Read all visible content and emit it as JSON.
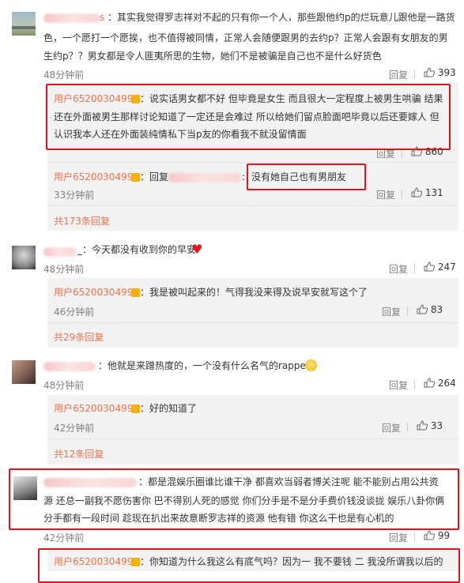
{
  "c1": {
    "name_suffix": "s",
    "line1": "：其实我觉得罗志祥对不起的只有你一个人，那些跟他约p的烂玩意儿跟他是一路货",
    "line2": "色，一个愿打一个愿挨，也不值得被同情，正常人会随便跟男的去约p？正常人会跟有女朋友的男",
    "line3": "生约p？？男女都是令人匪夷所思的生物，她们不是被骗是自己也不是什么好货色",
    "time": "48分钟前",
    "reply": "回复",
    "likes": "393"
  },
  "r1": {
    "user": "用户6520030499",
    "line1": "：说实话男女都不好 但毕竟是女生 而且很大一定程度上被男生哄骗 结果",
    "line2": "还在外面被男生那样讨论知道了一定还是会难过 所以给她们留点脸面吧毕竟以后还要嫁人 但",
    "line3": "认识我本人还在外面装纯情私下当p友的你看我不就没留情面",
    "reply": "回复",
    "likes": "860"
  },
  "r2": {
    "user": "用户6520030499",
    "prefix": "：回复",
    "suffix": ":",
    "highlight": "没有她自己也有男朋友",
    "time": "33分钟前",
    "reply": "回复",
    "likes": "131"
  },
  "more1": "共173条回复",
  "c2": {
    "name_suffix": "_",
    "text": "：今天都没有收到你的早安",
    "time": "48分钟前",
    "reply": "回复",
    "likes": "247"
  },
  "r3": {
    "user": "用户6520030499",
    "text": "：我是被叫起来的！气得我没来得及说早安就写这个了",
    "time": "46分钟前",
    "reply": "回复",
    "likes": "83"
  },
  "more2": "共29条回复",
  "c3": {
    "text": "：他就是来蹭热度的，一个没有什么名气的rapper",
    "time": "48分钟前",
    "reply": "回复",
    "likes": "264"
  },
  "r4": {
    "user": "用户6520030499",
    "text": "：好的知道了",
    "time": "42分钟前",
    "reply": "回复",
    "likes": "33"
  },
  "more3": "共12条回复",
  "c4": {
    "line1": "：都是混娱乐圈谁比谁干净  都喜欢当弱者博关注呢   能不能别占用公共资",
    "line2": "源  还总一副我不愿伤害你 巴不得别人死的感觉  你们分手是不是分手费价钱没谈拢   娱乐八卦你俩",
    "line3": "分手都有一段时间 趁现在扒出来故意断罗志祥的资源  他有错  你这么干也是有心机的",
    "time": "42分钟前",
    "reply": "回复",
    "likes": "99"
  },
  "r5": {
    "user": "用户6520030499",
    "text": "：你知道为什么我这么有底气吗？因为一 我不要钱 二 我没所谓我以后的"
  },
  "colors": {
    "accent": "#eb7350",
    "highlight_box": "#e0141e",
    "reply_bg": "#f2f2f2"
  }
}
